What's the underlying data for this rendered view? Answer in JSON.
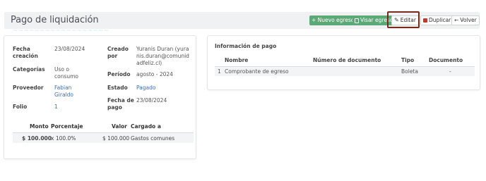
{
  "header": {
    "title": "Pago de liquidación",
    "buttons": {
      "nuevo_egreso": "+ Nuevo egreso",
      "visar_egreso": "Visar egreso",
      "editar": "Editar",
      "duplicar": "Duplicar",
      "volver": "Volver"
    }
  },
  "details": {
    "fecha_creacion_label": "Fecha creación",
    "fecha_creacion_value": "23/08/2024",
    "categorias_label": "Categorías",
    "categorias_value": "Uso o consumo",
    "proveedor_label": "Proveedor",
    "proveedor_value": "Fabian Giraldo",
    "folio_label": "Folio",
    "folio_value": "1",
    "creado_por_label": "Creado por",
    "creado_por_value": "Yuranis Duran (yuranis.duran@comunidadfeliz.cl)",
    "periodo_label": "Período",
    "periodo_value": "agosto - 2024",
    "estado_label": "Estado",
    "estado_value": "Pagado",
    "fecha_pago_label": "Fecha de pago",
    "fecha_pago_value": "23/08/2024"
  },
  "amounts_table": {
    "headers": [
      "Monto",
      "Porcentaje",
      "Valor",
      "Cargado a"
    ],
    "rows": [
      [
        "$ 100.000",
        "x 100.0%",
        "$ 100.000",
        "Gastos comunes"
      ]
    ]
  },
  "payment_info": {
    "title": "Información de pago",
    "headers": [
      "Nombre",
      "Número de documento",
      "Tipo",
      "Documento"
    ],
    "rows": [
      [
        "1",
        "Comprobante de egreso",
        "",
        "Boleta",
        "-"
      ]
    ]
  }
}
